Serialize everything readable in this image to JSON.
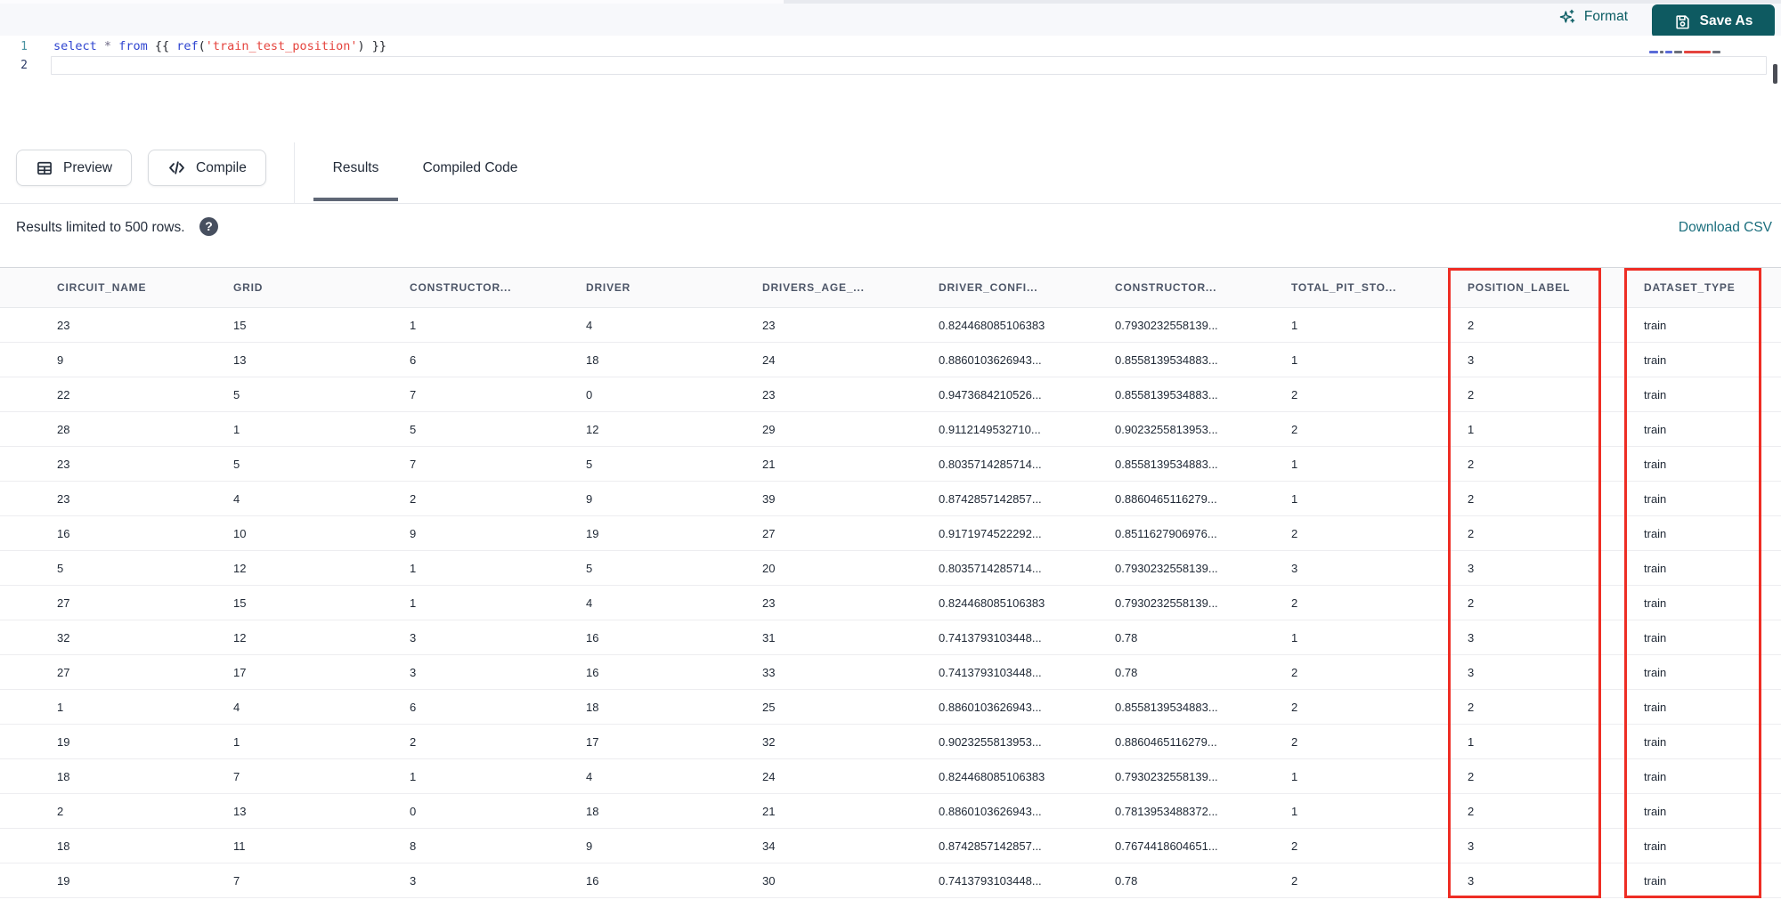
{
  "header": {
    "format_label": "Format",
    "save_as_label": "Save As"
  },
  "editor": {
    "lines": [
      {
        "num": "1",
        "tokens": [
          {
            "text": "select",
            "type": "keyword"
          },
          {
            "text": " ",
            "type": "plain"
          },
          {
            "text": "*",
            "type": "operator"
          },
          {
            "text": " ",
            "type": "plain"
          },
          {
            "text": "from",
            "type": "keyword"
          },
          {
            "text": " ",
            "type": "plain"
          },
          {
            "text": "{{ ",
            "type": "bracket"
          },
          {
            "text": "ref",
            "type": "function"
          },
          {
            "text": "(",
            "type": "bracket"
          },
          {
            "text": "'train_test_position'",
            "type": "string"
          },
          {
            "text": ")",
            "type": "bracket"
          },
          {
            "text": " }}",
            "type": "bracket"
          }
        ]
      },
      {
        "num": "2",
        "tokens": []
      }
    ]
  },
  "toolbar": {
    "preview_label": "Preview",
    "compile_label": "Compile",
    "tabs": [
      {
        "label": "Results",
        "active": true
      },
      {
        "label": "Compiled Code",
        "active": false
      }
    ]
  },
  "results_bar": {
    "info": "Results limited to 500 rows.",
    "help_icon": "?",
    "download_label": "Download CSV"
  },
  "table": {
    "columns": [
      "CIRCUIT_NAME",
      "GRID",
      "CONSTRUCTOR...",
      "DRIVER",
      "DRIVERS_AGE_...",
      "DRIVER_CONFI...",
      "CONSTRUCTOR...",
      "TOTAL_PIT_STO...",
      "POSITION_LABEL",
      "DATASET_TYPE"
    ],
    "rows": [
      [
        "23",
        "15",
        "1",
        "4",
        "23",
        "0.824468085106383",
        "0.7930232558139...",
        "1",
        "2",
        "train"
      ],
      [
        "9",
        "13",
        "6",
        "18",
        "24",
        "0.8860103626943...",
        "0.8558139534883...",
        "1",
        "3",
        "train"
      ],
      [
        "22",
        "5",
        "7",
        "0",
        "23",
        "0.9473684210526...",
        "0.8558139534883...",
        "2",
        "2",
        "train"
      ],
      [
        "28",
        "1",
        "5",
        "12",
        "29",
        "0.9112149532710...",
        "0.9023255813953...",
        "2",
        "1",
        "train"
      ],
      [
        "23",
        "5",
        "7",
        "5",
        "21",
        "0.8035714285714...",
        "0.8558139534883...",
        "1",
        "2",
        "train"
      ],
      [
        "23",
        "4",
        "2",
        "9",
        "39",
        "0.8742857142857...",
        "0.8860465116279...",
        "1",
        "2",
        "train"
      ],
      [
        "16",
        "10",
        "9",
        "19",
        "27",
        "0.9171974522292...",
        "0.8511627906976...",
        "2",
        "2",
        "train"
      ],
      [
        "5",
        "12",
        "1",
        "5",
        "20",
        "0.8035714285714...",
        "0.7930232558139...",
        "3",
        "3",
        "train"
      ],
      [
        "27",
        "15",
        "1",
        "4",
        "23",
        "0.824468085106383",
        "0.7930232558139...",
        "2",
        "2",
        "train"
      ],
      [
        "32",
        "12",
        "3",
        "16",
        "31",
        "0.7413793103448...",
        "0.78",
        "1",
        "3",
        "train"
      ],
      [
        "27",
        "17",
        "3",
        "16",
        "33",
        "0.7413793103448...",
        "0.78",
        "2",
        "3",
        "train"
      ],
      [
        "1",
        "4",
        "6",
        "18",
        "25",
        "0.8860103626943...",
        "0.8558139534883...",
        "2",
        "2",
        "train"
      ],
      [
        "19",
        "1",
        "2",
        "17",
        "32",
        "0.9023255813953...",
        "0.8860465116279...",
        "2",
        "1",
        "train"
      ],
      [
        "18",
        "7",
        "1",
        "4",
        "24",
        "0.824468085106383",
        "0.7930232558139...",
        "1",
        "2",
        "train"
      ],
      [
        "2",
        "13",
        "0",
        "18",
        "21",
        "0.8860103626943...",
        "0.7813953488372...",
        "1",
        "2",
        "train"
      ],
      [
        "18",
        "11",
        "8",
        "9",
        "34",
        "0.8742857142857...",
        "0.7674418604651...",
        "2",
        "3",
        "train"
      ],
      [
        "19",
        "7",
        "3",
        "16",
        "30",
        "0.7413793103448...",
        "0.78",
        "2",
        "3",
        "train"
      ]
    ]
  },
  "annotations": {
    "highlighted_columns": [
      "POSITION_LABEL",
      "DATASET_TYPE"
    ]
  },
  "colors": {
    "accent_teal": "#0e5a61",
    "link_teal": "#1a6e7d",
    "annotation_red": "#ee2d24"
  }
}
